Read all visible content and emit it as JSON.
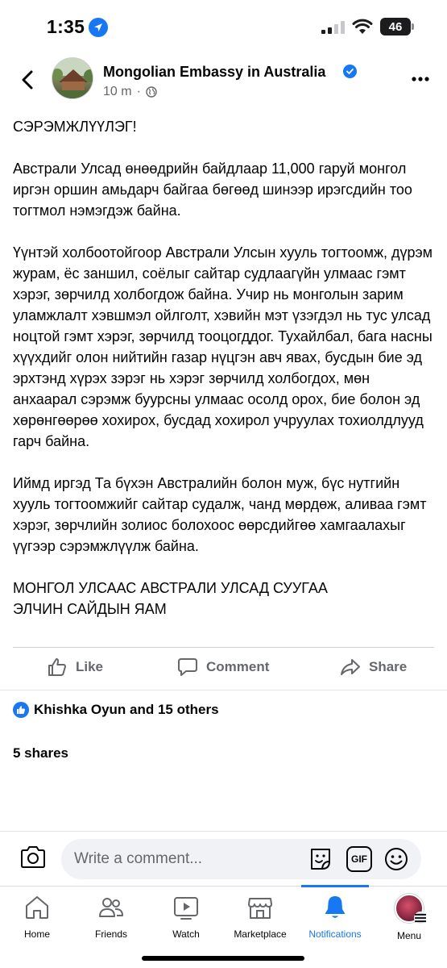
{
  "status_bar": {
    "time": "1:35",
    "battery": "46",
    "icons": [
      "location-arrow-icon",
      "signal-icon",
      "wifi-icon",
      "battery-icon"
    ]
  },
  "header": {
    "page_name": "Mongolian Embassy in Australia",
    "time_ago": "10 m",
    "separator": "·",
    "icons": [
      "back-chevron-icon",
      "verified-badge-icon",
      "globe-icon",
      "more-dots-icon"
    ]
  },
  "post": {
    "paragraphs": [
      "СЭРЭМЖЛҮҮЛЭГ!",
      "Австрали Улсад өнөөдрийн байдлаар 11,000 гаруй монгол иргэн оршин амьдарч байгаа бөгөөд шинээр ирэгсдийн тоо тогтмол нэмэгдэж байна.",
      "Үүнтэй холбоотойгоор Австрали Улсын хууль тогтоомж, дүрэм журам, ёс заншил, соёлыг сайтар судлаагүйн улмаас гэмт хэрэг, зөрчилд холбогдож байна. Учир нь монголын зарим уламжлалт хэвшмэл ойлголт, хэвийн мэт үзэгдэл нь тус улсад ноцтой гэмт хэрэг, зөрчилд тооцогддог. Тухайлбал,  бага насны хүүхдийг олон нийтийн газар нүцгэн авч явах, бусдын бие эд эрхтэнд хүрэх зэрэг нь хэрэг зөрчилд холбогдох, мөн анхаарал сэрэмж буурсны улмаас осолд орох, бие болон эд хөрөнгөөрөө хохирох, бусдад хохирол учруулах тохиолдлууд гарч байна.",
      "Иймд иргэд Та бүхэн Австралийн болон муж, бүс нутгийн хууль тогтоомжийг сайтар судалж, чанд мөрдөж, аливаа гэмт хэрэг, зөрчлийн золиос болохоос өөрсдийгөө хамгаалахыг үүгээр сэрэмжлүүлж байна.",
      "МОНГОЛ УЛСААС АВСТРАЛИ УЛСАД СУУГАА\nЭЛЧИН САЙДЫН ЯАМ"
    ]
  },
  "actions": {
    "like": "Like",
    "comment": "Comment",
    "share": "Share"
  },
  "reactions": {
    "summary": "Khishka Oyun and 15 others"
  },
  "shares": {
    "text": "5 shares"
  },
  "composer": {
    "placeholder": "Write a comment...",
    "icons": [
      "camera-icon",
      "sticker-icon",
      "gif-icon",
      "emoji-icon"
    ],
    "gif_label": "GIF"
  },
  "tabbar": {
    "tabs": [
      {
        "label": "Home",
        "icon": "home-icon"
      },
      {
        "label": "Friends",
        "icon": "friends-icon"
      },
      {
        "label": "Watch",
        "icon": "watch-icon"
      },
      {
        "label": "Marketplace",
        "icon": "marketplace-icon"
      },
      {
        "label": "Notifications",
        "icon": "bell-icon"
      },
      {
        "label": "Menu",
        "icon": "avatar-icon"
      }
    ],
    "active": "Notifications"
  },
  "colors": {
    "accent": "#1877f2",
    "secondary_text": "#65676b",
    "primary_text": "#050505"
  }
}
